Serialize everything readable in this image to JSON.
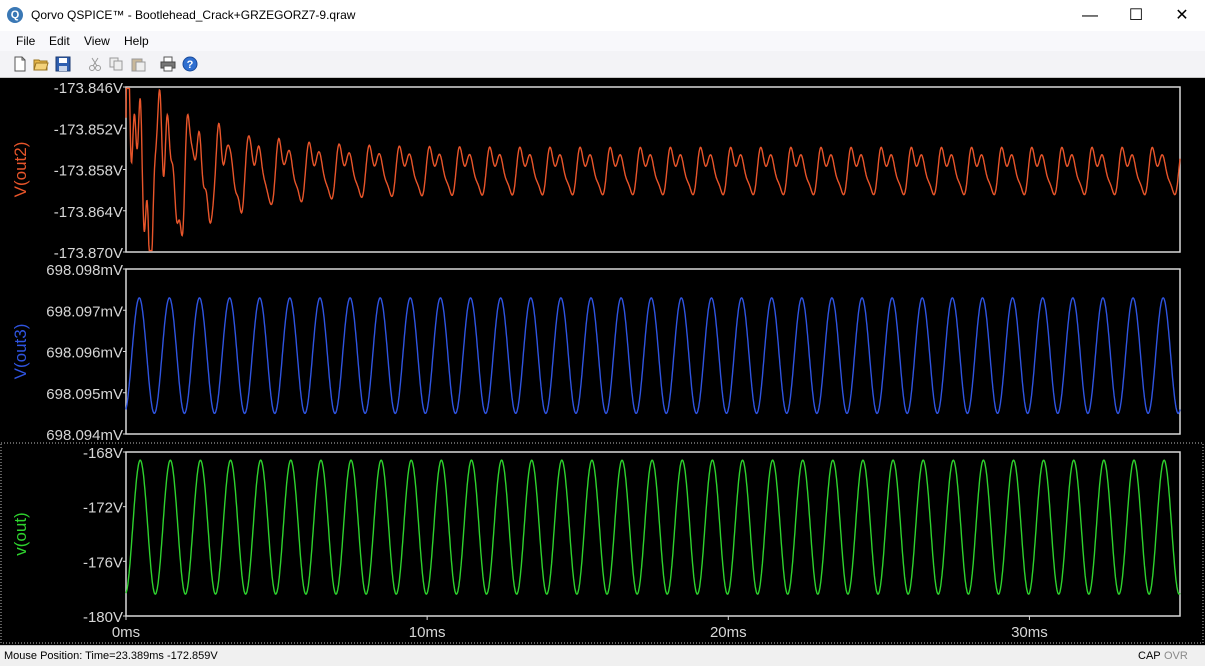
{
  "window": {
    "title": "Qorvo QSPICE™ - Bootlehead_Crack+GRZEGORZ7-9.qraw",
    "icon": "qspice-app-icon",
    "minimize_glyph": "—",
    "maximize_glyph": "☐",
    "close_glyph": "✕"
  },
  "menu": {
    "items": [
      "File",
      "Edit",
      "View",
      "Help"
    ]
  },
  "toolbar": {
    "buttons": [
      "new-file-icon",
      "open-folder-icon",
      "save-icon",
      "cut-icon",
      "copy-icon",
      "paste-icon",
      "print-icon",
      "help-icon"
    ]
  },
  "status": {
    "mouse_position": "Mouse Position: Time=23.389ms  -172.859V",
    "cap": "CAP",
    "ovr": "OVR"
  },
  "chart_data": [
    {
      "type": "line",
      "title": "",
      "ylabel": "V(out2)",
      "color": "#e8552a",
      "yticks": [
        "-173.846V",
        "-173.852V",
        "-173.858V",
        "-173.864V",
        "-173.870V"
      ],
      "ylim": [
        -173.87,
        -173.846
      ],
      "xlim": [
        0,
        35
      ],
      "series": [
        {
          "name": "V(out2)",
          "description": "decaying multi-tone oscillation around -173.858V",
          "x_unit": "ms"
        }
      ]
    },
    {
      "type": "line",
      "title": "",
      "ylabel": "V(out3)",
      "color": "#2f54e0",
      "yticks": [
        "698.098mV",
        "698.097mV",
        "698.096mV",
        "698.095mV",
        "698.094mV"
      ],
      "ylim": [
        698.094,
        698.098
      ],
      "xlim": [
        0,
        35
      ],
      "series": [
        {
          "name": "V(out3)",
          "frequency_hz": 1000,
          "offset_mv": 698.0959,
          "amplitude_mv": 0.0014
        }
      ]
    },
    {
      "type": "line",
      "title": "",
      "ylabel": "v(out)",
      "color": "#2ed22e",
      "yticks": [
        "-168V",
        "-172V",
        "-176V",
        "-180V"
      ],
      "ylim": [
        -180,
        -168
      ],
      "xlim": [
        0,
        35
      ],
      "xticks": [
        "0ms",
        "10ms",
        "20ms",
        "30ms"
      ],
      "series": [
        {
          "name": "v(out)",
          "frequency_hz": 1000,
          "offset_v": -173.5,
          "amplitude_v": 4.9
        }
      ]
    }
  ]
}
